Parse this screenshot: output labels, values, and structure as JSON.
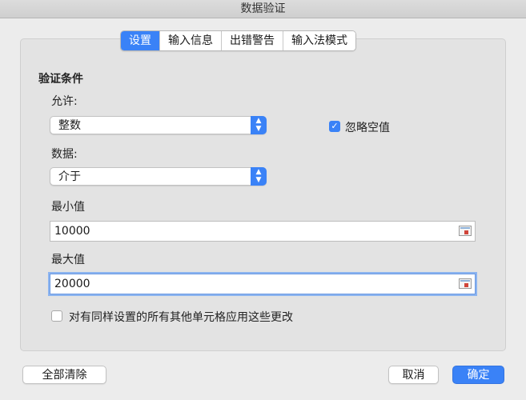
{
  "window": {
    "title": "数据验证"
  },
  "tabs": [
    {
      "label": "设置",
      "active": true
    },
    {
      "label": "输入信息",
      "active": false
    },
    {
      "label": "出错警告",
      "active": false
    },
    {
      "label": "输入法模式",
      "active": false
    }
  ],
  "settings": {
    "section_title": "验证条件",
    "allow": {
      "label": "允许:",
      "value": "整数"
    },
    "ignore_blank": {
      "label": "忽略空值",
      "checked": true
    },
    "data": {
      "label": "数据:",
      "value": "介于"
    },
    "minimum": {
      "label": "最小值",
      "value": "10000"
    },
    "maximum": {
      "label": "最大值",
      "value": "20000"
    },
    "apply_all": {
      "label": "对有同样设置的所有其他单元格应用这些更改",
      "checked": false
    }
  },
  "footer": {
    "clear_all": "全部清除",
    "cancel": "取消",
    "ok": "确定"
  },
  "icons": {
    "checkmark": "✓",
    "stepper": "▴▾"
  },
  "colors": {
    "accent": "#3a82f7"
  }
}
